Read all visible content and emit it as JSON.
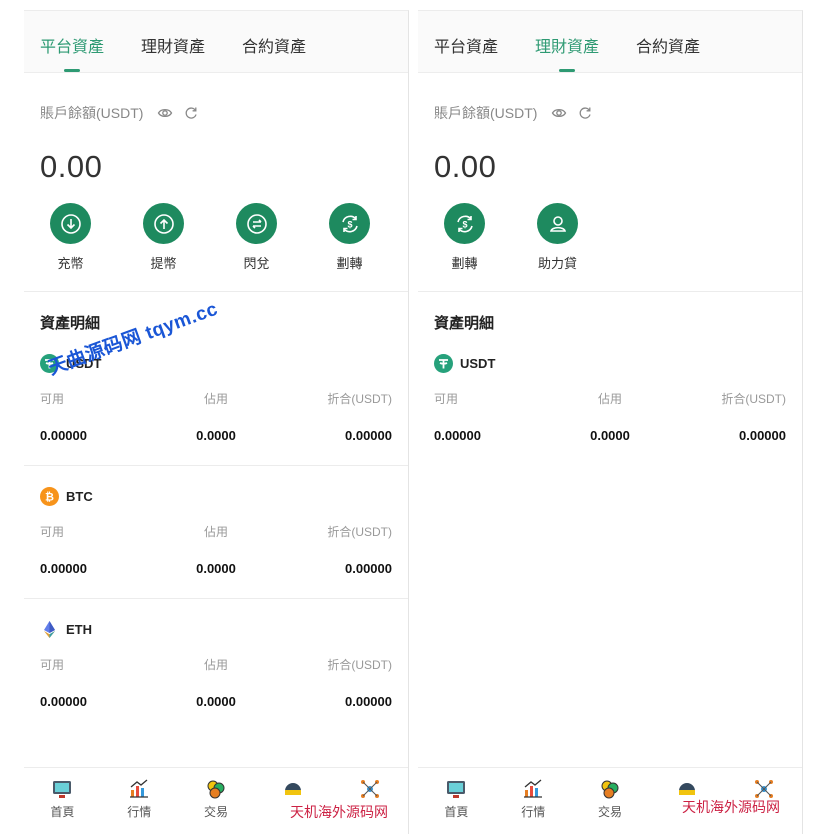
{
  "tabs": [
    "平台資產",
    "理財資產",
    "合約資產"
  ],
  "left": {
    "active_tab": 0,
    "balance_label": "賬戶餘額(USDT)",
    "balance": "0.00",
    "actions": [
      {
        "label": "充幣",
        "icon": "deposit-icon"
      },
      {
        "label": "提幣",
        "icon": "withdraw-icon"
      },
      {
        "label": "閃兌",
        "icon": "exchange-icon"
      },
      {
        "label": "劃轉",
        "icon": "transfer-icon"
      }
    ],
    "section_title": "資產明細",
    "assets": [
      {
        "name": "USDT",
        "col_labels": [
          "可用",
          "佔用",
          "折合(USDT)"
        ],
        "values": [
          "0.00000",
          "0.0000",
          "0.00000"
        ]
      },
      {
        "name": "BTC",
        "col_labels": [
          "可用",
          "佔用",
          "折合(USDT)"
        ],
        "values": [
          "0.00000",
          "0.0000",
          "0.00000"
        ]
      },
      {
        "name": "ETH",
        "col_labels": [
          "可用",
          "佔用",
          "折合(USDT)"
        ],
        "values": [
          "0.00000",
          "0.0000",
          "0.00000"
        ]
      }
    ]
  },
  "right": {
    "active_tab": 1,
    "balance_label": "賬戶餘額(USDT)",
    "balance": "0.00",
    "actions": [
      {
        "label": "劃轉",
        "icon": "transfer-icon"
      },
      {
        "label": "助力貸",
        "icon": "loan-icon"
      }
    ],
    "section_title": "資產明細",
    "assets": [
      {
        "name": "USDT",
        "col_labels": [
          "可用",
          "佔用",
          "折合(USDT)"
        ],
        "values": [
          "0.00000",
          "0.0000",
          "0.00000"
        ]
      }
    ]
  },
  "bottom_nav": [
    "首頁",
    "行情",
    "交易",
    "",
    ""
  ],
  "watermarks": {
    "blue": "天曲源码网 tqym.cc",
    "red": "天机海外源码网"
  },
  "colors": {
    "accent": "#2e9a73",
    "action_circle": "#1e8a5f",
    "usdt": "#26a17b",
    "btc": "#f7931a",
    "eth": "#627eea"
  }
}
